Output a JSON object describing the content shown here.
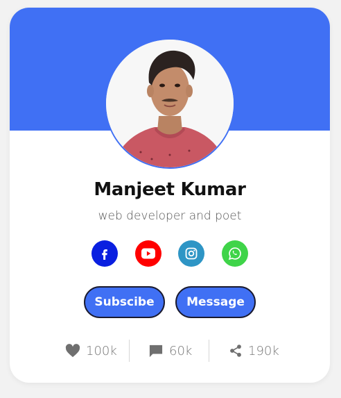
{
  "profile": {
    "name": "Manjeet Kumar",
    "role": "web developer and poet"
  },
  "socials": [
    {
      "name": "facebook-icon",
      "color": "#0a1fe0"
    },
    {
      "name": "youtube-icon",
      "color": "#ff0000"
    },
    {
      "name": "instagram-icon",
      "color": "#2e95c5"
    },
    {
      "name": "whatsapp-icon",
      "color": "#3fd449"
    }
  ],
  "buttons": {
    "subscribe_label": "Subscibe",
    "message_label": "Message"
  },
  "stats": {
    "likes": "100k",
    "comments": "60k",
    "shares": "190k"
  },
  "colors": {
    "accent": "#4070f4",
    "background": "#f2f2f2",
    "card": "#ffffff"
  }
}
